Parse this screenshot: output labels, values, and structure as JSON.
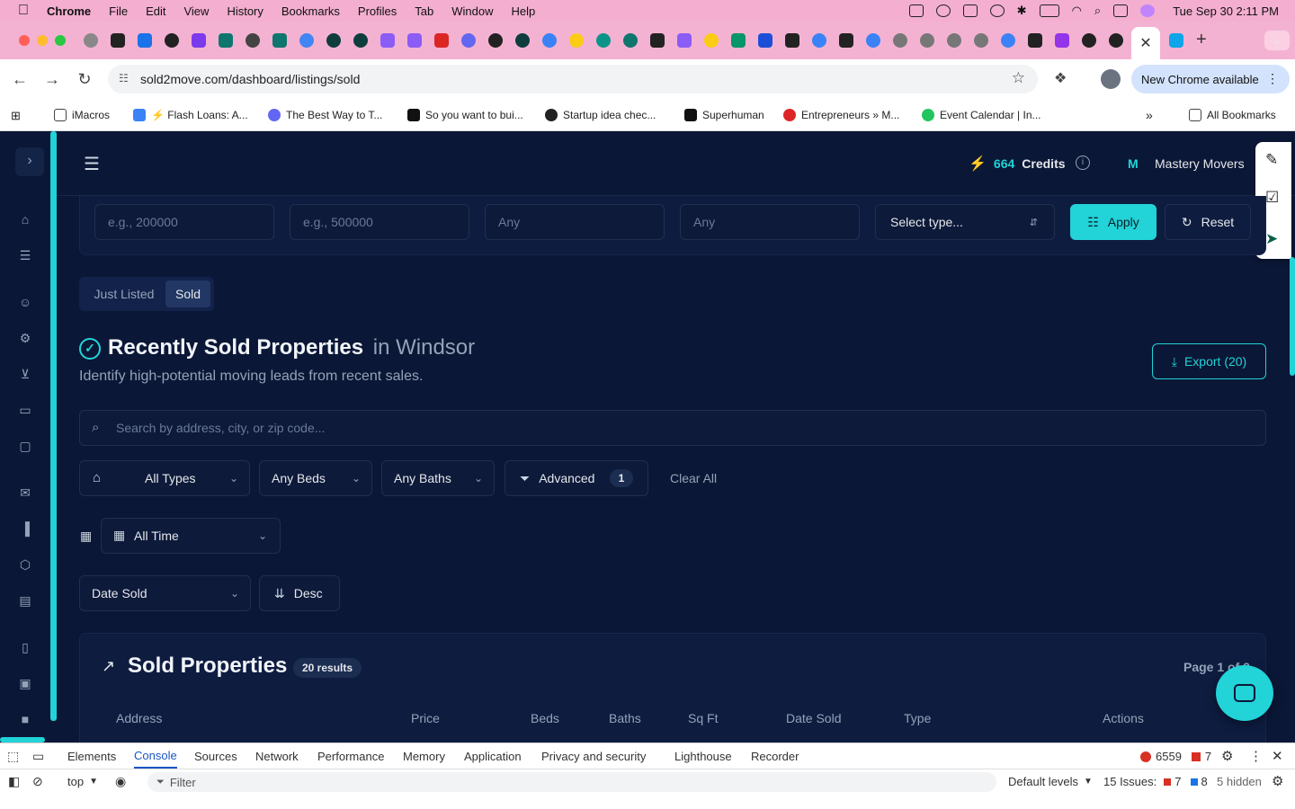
{
  "menubar": {
    "app": "Chrome",
    "items": [
      "File",
      "Edit",
      "View",
      "History",
      "Bookmarks",
      "Profiles",
      "Tab",
      "Window",
      "Help"
    ],
    "clock": "Tue Sep 30  2:11 PM"
  },
  "toolbar": {
    "url": "sold2move.com/dashboard/listings/sold",
    "new_chrome": "New Chrome available"
  },
  "bookmarks": [
    "iMacros",
    "⚡ Flash Loans: A...",
    "The Best Way to T...",
    "So you want to bui...",
    "Startup idea chec...",
    "Superhuman",
    "Entrepreneurs » M...",
    "Event Calendar | In..."
  ],
  "bookmarks_all": "All Bookmarks",
  "header": {
    "credits_value": "664",
    "credits_label": "Credits",
    "avatar_letter": "M",
    "company": "Mastery Movers"
  },
  "filters": {
    "min_price_placeholder": "e.g., 200000",
    "max_price_placeholder": "e.g., 500000",
    "beds_placeholder": "Any",
    "baths_placeholder": "Any",
    "type_select": "Select type...",
    "apply": "Apply",
    "reset": "Reset"
  },
  "toggle": {
    "just_listed": "Just Listed",
    "sold": "Sold"
  },
  "section": {
    "title": "Recently Sold Properties",
    "location": "in Windsor",
    "subtitle": "Identify high-potential moving leads from recent sales.",
    "export": "Export (20)"
  },
  "search": {
    "placeholder": "Search by address, city, or zip code..."
  },
  "filterbar": {
    "types": "All Types",
    "beds": "Any Beds",
    "baths": "Any Baths",
    "advanced": "Advanced",
    "advanced_count": "1",
    "clear": "Clear All",
    "time": "All Time",
    "sort_field": "Date Sold",
    "sort_order": "Desc"
  },
  "results": {
    "title": "Sold Properties",
    "count": "20 results",
    "page": "Page 1 of 2",
    "columns": [
      "Address",
      "Price",
      "Beds",
      "Baths",
      "Sq Ft",
      "Date Sold",
      "Type",
      "Actions"
    ]
  },
  "devtools": {
    "tabs": [
      "Elements",
      "Console",
      "Sources",
      "Network",
      "Performance",
      "Memory",
      "Application",
      "Privacy and security",
      "Lighthouse",
      "Recorder"
    ],
    "errors": "6559",
    "warnings": "7",
    "context": "top",
    "filter": "Filter",
    "levels": "Default levels",
    "issues_label": "15 Issues:",
    "issues_err": "7",
    "issues_info": "8",
    "hidden": "5 hidden"
  },
  "colors": {
    "accent": "#22d3d8",
    "background": "#0b1736",
    "card": "#0e1c40"
  }
}
